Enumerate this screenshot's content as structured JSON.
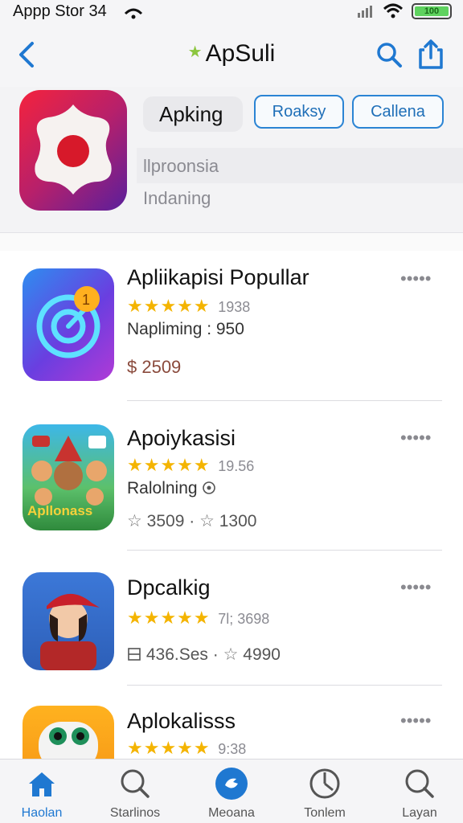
{
  "status_bar": {
    "carrier": "Appp Stor 34",
    "battery": "100"
  },
  "nav": {
    "title": "ApSuli",
    "star_glyph": "★"
  },
  "hero": {
    "name": "Apking",
    "button_1": "Roaksy",
    "button_2": "Callena",
    "subtitle": "llproonsia",
    "status": "Indaning"
  },
  "apps": [
    {
      "title": "Apliikapisi  Popullar",
      "rating_count": "1938",
      "meta": "Napliming : 950",
      "price": "$ 2509",
      "stars": "★★★★★"
    },
    {
      "title": "Apoiykasisi",
      "rating_count": "19.56",
      "meta": "Ralolning",
      "stat_1": "3509",
      "stat_2": "1300",
      "art_text": "Apllonass",
      "stars": "★★★★★"
    },
    {
      "title": "Dpcalkig",
      "rating_count": "7l; 3698",
      "meta": "436.Ses",
      "stat_2": "4990",
      "stars": "★★★★★"
    },
    {
      "title": "Aplokalisss",
      "rating_count": "9:38",
      "stars": "★★★★★"
    }
  ],
  "more_glyph": "•••••",
  "separator": "·",
  "tabs": [
    {
      "label": "Haolan",
      "active": true
    },
    {
      "label": "Starlinos",
      "active": false
    },
    {
      "label": "Meoana",
      "active": false
    },
    {
      "label": "Tonlem",
      "active": false
    },
    {
      "label": "Layan",
      "active": false
    }
  ],
  "colors": {
    "accent": "#1f78d1",
    "star": "#f4b400",
    "hero_icon_start": "#f4233d",
    "hero_icon_end": "#5a1f9c"
  }
}
